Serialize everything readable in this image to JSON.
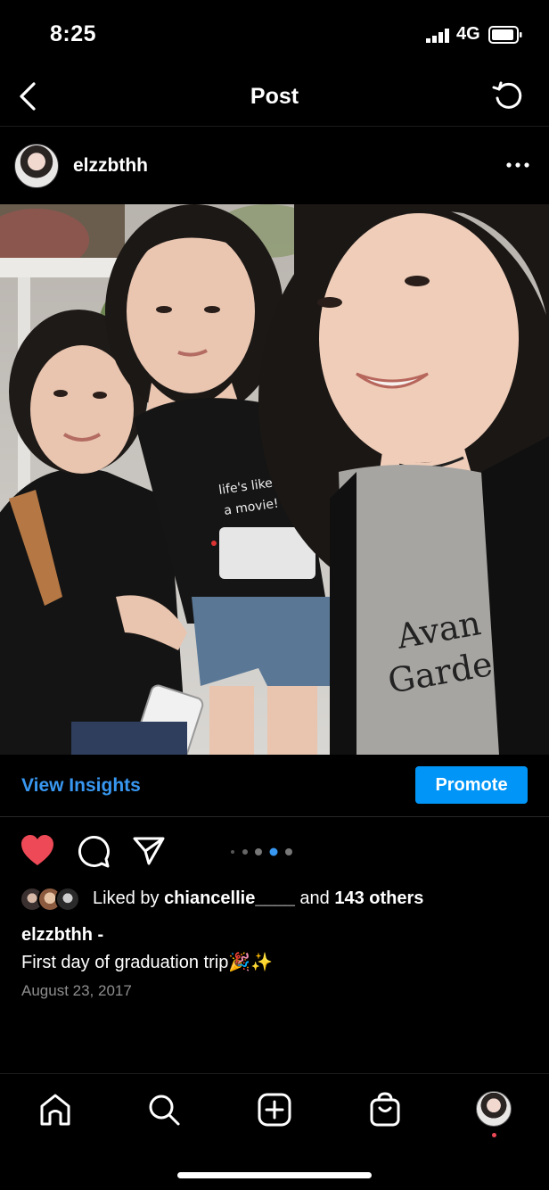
{
  "status_bar": {
    "time": "8:25",
    "network": "4G"
  },
  "nav": {
    "title": "Post"
  },
  "post": {
    "username": "elzzbthh",
    "likes": {
      "prefix": "Liked by ",
      "user": "chiancellie____",
      "middle": " and ",
      "count": "143 others"
    },
    "caption_user": "elzzbthh -",
    "caption_text": "First day of graduation trip🎉✨",
    "date": "August 23, 2017",
    "carousel": {
      "total": 5,
      "active_index": 3
    }
  },
  "insights": {
    "view_label": "View Insights",
    "promote_label": "Promote"
  },
  "icons": {
    "back": "chevron-left-icon",
    "refresh": "refresh-icon",
    "more": "more-horizontal-icon",
    "like": "heart-filled-icon",
    "comment": "comment-icon",
    "share": "send-icon",
    "home": "home-icon",
    "search": "search-icon",
    "create": "plus-square-icon",
    "shop": "shopping-bag-icon"
  },
  "colors": {
    "background": "#000000",
    "link_blue": "#3897f0",
    "promote_blue": "#0095f6",
    "heart_red": "#ed4956",
    "muted": "#8e8e8e"
  }
}
